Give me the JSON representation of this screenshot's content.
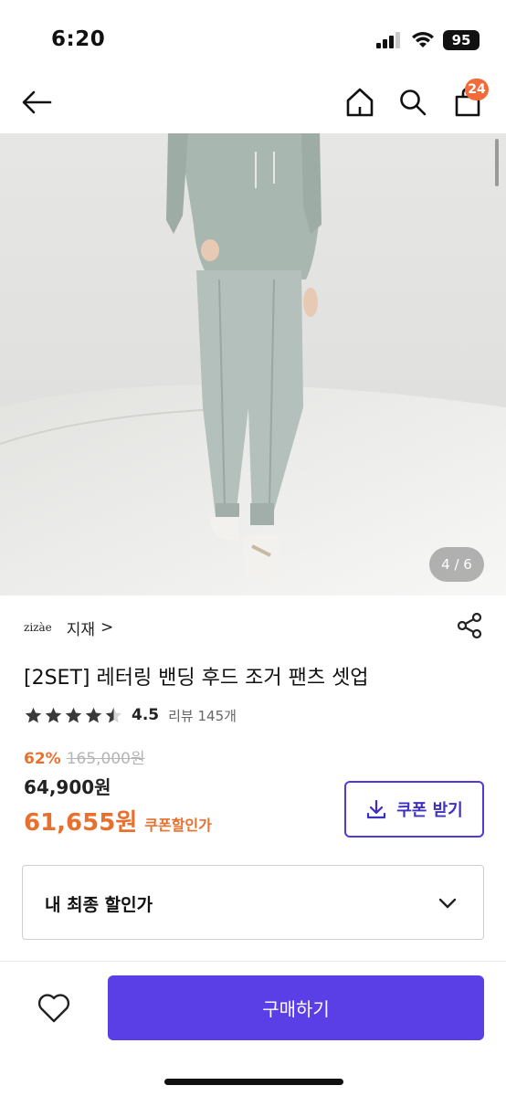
{
  "status_bar": {
    "time": "6:20",
    "battery": "95"
  },
  "nav": {
    "cart_count": "24",
    "icons": [
      "back-arrow-icon",
      "home-icon",
      "search-icon",
      "shopping-bag-icon"
    ]
  },
  "gallery": {
    "pager": "4 / 6"
  },
  "brand": {
    "logo_text": "zizàe",
    "name": "지재",
    "chevron": ">"
  },
  "product": {
    "title": "[2SET] 레터링 밴딩 후드 조거 팬츠 셋업",
    "rating": "4.5",
    "rating_fraction": 0.9,
    "review_label": "리뷰 145개",
    "discount_rate": "62%",
    "original_price": "165,000원",
    "sale_price": "64,900원",
    "coupon_price": "61,655원",
    "coupon_price_label": "쿠폰할인가"
  },
  "coupon_button": {
    "label": "쿠폰 받기"
  },
  "final_price": {
    "label": "내 최종 할인가"
  },
  "bottom_bar": {
    "buy_label": "구매하기"
  },
  "colors": {
    "accent": "#5a3fe6",
    "discount": "#e8702f",
    "badge": "#f26b3a"
  }
}
